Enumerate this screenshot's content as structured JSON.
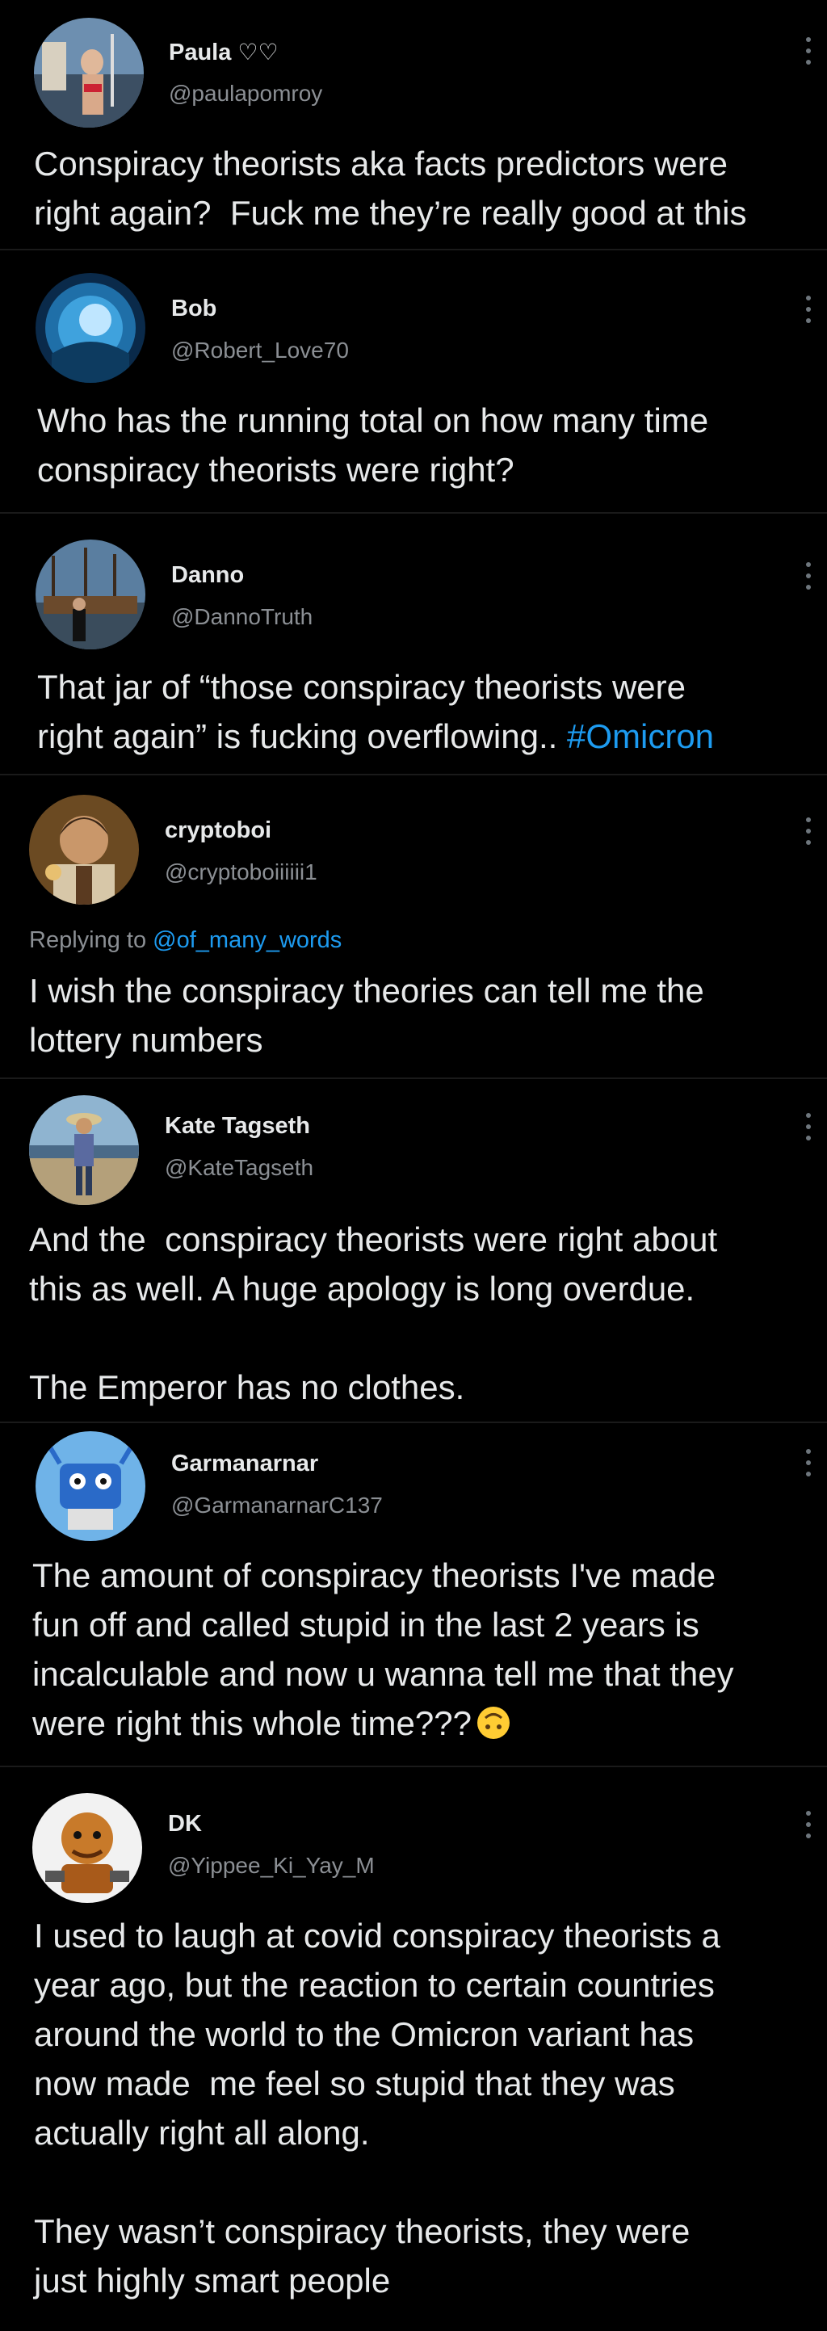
{
  "tweets": [
    {
      "name": "Paula",
      "name_suffix": "♡♡",
      "handle": "@paulapomroy",
      "text_lines": [
        "Conspiracy theorists aka facts predictors were",
        "right again?  Fuck me they’re really good at this"
      ]
    },
    {
      "name": "Bob",
      "handle": "@Robert_Love70",
      "text_lines": [
        "Who has the running total on how many time",
        "conspiracy theorists were right?"
      ]
    },
    {
      "name": "Danno",
      "handle": "@DannoTruth",
      "text_lines": [
        "That jar of “those conspiracy theorists were",
        "right again” is fucking overflowing.. "
      ],
      "hashtag": "#Omicron"
    },
    {
      "name": "cryptoboi",
      "handle": "@cryptoboiiiiii1",
      "replying_prefix": "Replying to ",
      "replying_to": "@of_many_words",
      "text_lines": [
        "I wish the conspiracy theories can tell me the",
        "lottery numbers"
      ]
    },
    {
      "name": "Kate Tagseth",
      "handle": "@KateTagseth",
      "text_lines": [
        "And the  conspiracy theorists were right about",
        "this as well. A huge apology is long overdue.",
        "",
        "The Emperor has no clothes."
      ]
    },
    {
      "name": "Garmanarnar",
      "handle": "@GarmanarnarC137",
      "text_lines": [
        "The amount of conspiracy theorists I've made",
        "fun off and called stupid in the last 2 years is",
        "incalculable and now u wanna tell me that they",
        "were right this whole time???"
      ],
      "emoji": "upside-down-face-emoji"
    },
    {
      "name": "DK",
      "handle": "@Yippee_Ki_Yay_M",
      "text_lines": [
        "I used to laugh at covid conspiracy theorists a",
        "year ago, but the reaction to certain countries",
        "around the world to the Omicron variant has",
        "now made  me feel so stupid that they was",
        "actually right all along.",
        "",
        "They wasn’t conspiracy theorists, they were",
        "just highly smart people"
      ]
    }
  ],
  "icons": {
    "more": "more-options-icon"
  },
  "colors": {
    "background": "#000000",
    "text": "#e7e9ea",
    "secondary": "#8b8f94",
    "link": "#1d9bf0"
  }
}
